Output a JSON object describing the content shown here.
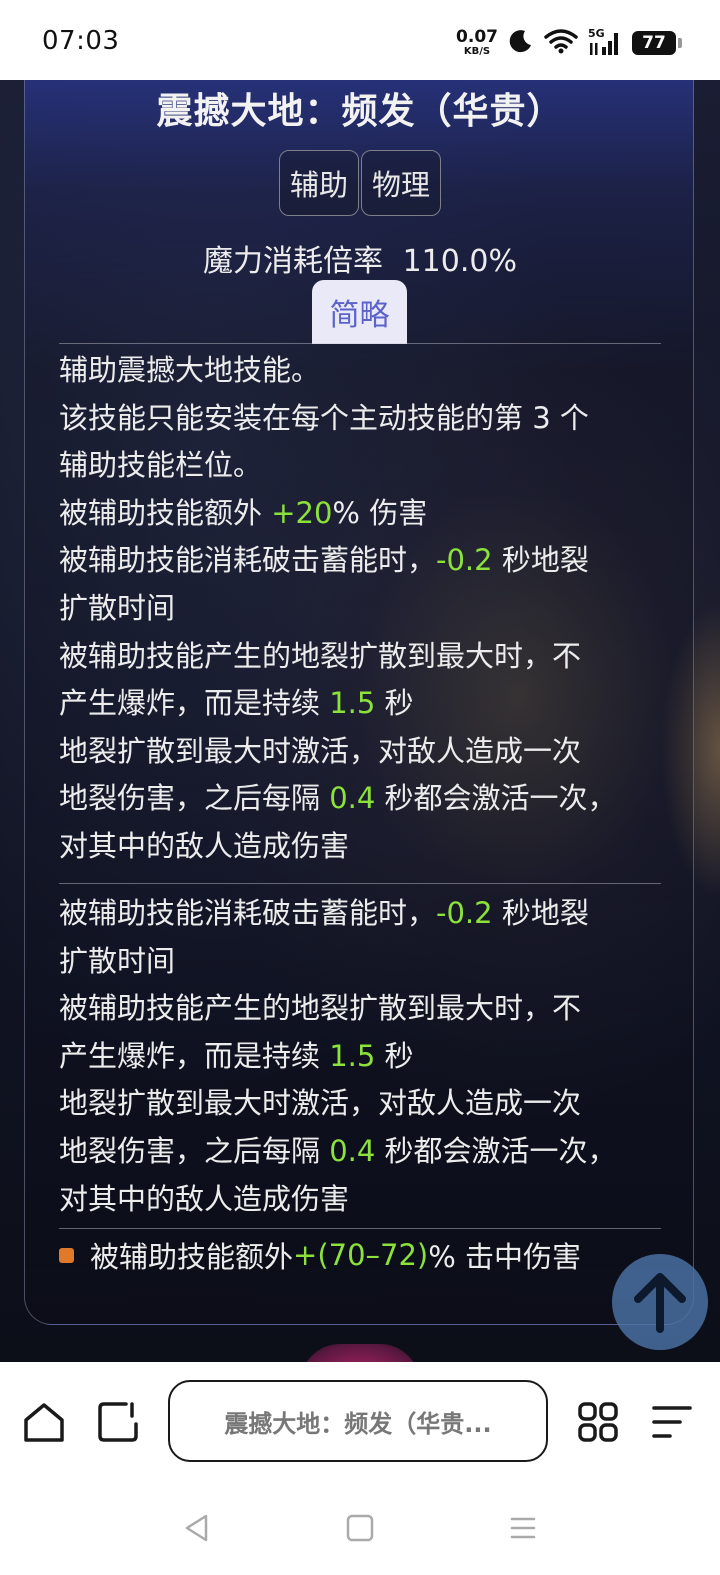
{
  "status": {
    "time": "07:03",
    "net_speed_value": "0.07",
    "net_speed_unit": "KB/S",
    "signal_label": "5G",
    "battery": "77"
  },
  "skill": {
    "title": "震撼大地：频发（华贵）",
    "tags": [
      "辅助",
      "物理"
    ],
    "cost_label": "魔力消耗倍率",
    "cost_value": "110.0%",
    "brief_button": "简略"
  },
  "description": {
    "line1": "辅助震撼大地技能。",
    "line2": "该技能只能安装在每个主动技能的第 3 个",
    "line3": "辅助技能栏位。",
    "dmg_prefix": "被辅助技能额外 ",
    "dmg_value": "+20",
    "dmg_suffix": "% 伤害",
    "block_a": {
      "consume_prefix": "被辅助技能消耗破击蓄能时，",
      "consume_value": "-0.2",
      "consume_suffix": " 秒地裂",
      "consume_line2": "扩散时间",
      "expand_line1": "被辅助技能产生的地裂扩散到最大时，不",
      "expand_prefix": "产生爆炸，而是持续 ",
      "expand_value": "1.5",
      "expand_suffix": " 秒",
      "activate_line1": "地裂扩散到最大时激活，对敌人造成一次",
      "activate_prefix": "地裂伤害，之后每隔 ",
      "activate_value": "0.4",
      "activate_suffix": " 秒都会激活一次，",
      "activate_line3": "对其中的敌人造成伤害"
    },
    "block_b": {
      "consume_prefix": "被辅助技能消耗破击蓄能时，",
      "consume_value": "-0.2",
      "consume_suffix": " 秒地裂",
      "consume_line2": "扩散时间",
      "expand_line1": "被辅助技能产生的地裂扩散到最大时，不",
      "expand_prefix": "产生爆炸，而是持续 ",
      "expand_value": "1.5",
      "expand_suffix": " 秒",
      "activate_line1": "地裂扩散到最大时激活，对敌人造成一次",
      "activate_prefix": "地裂伤害，之后每隔 ",
      "activate_value": "0.4",
      "activate_suffix": " 秒都会激活一次，",
      "activate_line3": "对其中的敌人造成伤害"
    },
    "affix_prefix": "被辅助技能额外 ",
    "affix_value": "+(70–72)",
    "affix_suffix": "% 击中伤害"
  },
  "browser": {
    "address_text": "震撼大地：频发（华贵..."
  },
  "colors": {
    "value_green": "#8ce23a",
    "bullet_orange": "#e07a28",
    "brief_button_text": "#5c63c9"
  }
}
